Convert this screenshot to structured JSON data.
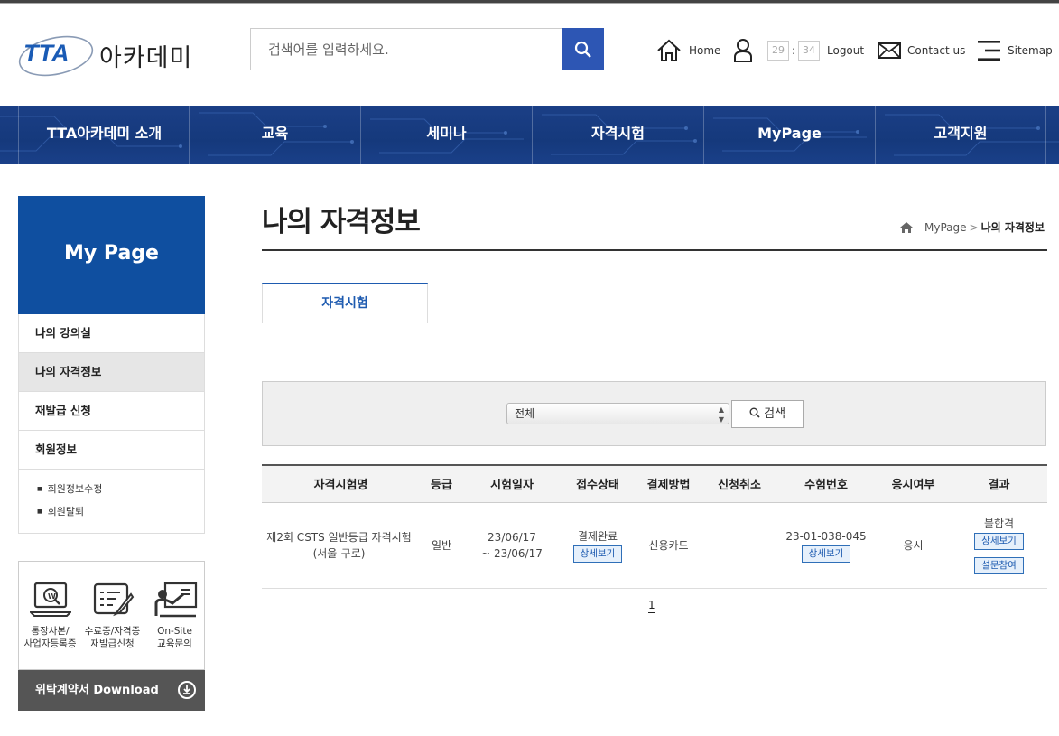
{
  "header": {
    "logo_text": "TTA",
    "brand": "아카데미",
    "search_placeholder": "검색어를 입력하세요.",
    "util": {
      "home": "Home",
      "timer_min": "29",
      "timer_sep": ":",
      "timer_sec": "34",
      "logout": "Logout",
      "contact": "Contact us",
      "sitemap": "Sitemap"
    }
  },
  "nav": [
    "TTA아카데미 소개",
    "교육",
    "세미나",
    "자격시험",
    "MyPage",
    "고객지원"
  ],
  "sidebar": {
    "title": "My Page",
    "items": [
      {
        "label": "나의 강의실"
      },
      {
        "label": "나의 자격정보"
      },
      {
        "label": "재발급 신청"
      },
      {
        "label": "회원정보"
      }
    ],
    "subitems": [
      "회원정보수정",
      "회원탈퇴"
    ],
    "quick": [
      {
        "line1": "통장사본/",
        "line2": "사업자등록증"
      },
      {
        "line1": "수료증/자격증",
        "line2": "재발급신청"
      },
      {
        "line1": "On-Site",
        "line2": "교육문의"
      }
    ],
    "download": "위탁계약서 Download"
  },
  "main": {
    "title": "나의 자격정보",
    "breadcrumb": {
      "parent": "MyPage",
      "sep": ">",
      "current": "나의 자격정보"
    },
    "tab": "자격시험",
    "filter": {
      "select_value": "전체",
      "search_button": "검색"
    },
    "table": {
      "headers": [
        "자격시험명",
        "등급",
        "시험일자",
        "접수상태",
        "결제방법",
        "신청취소",
        "수험번호",
        "응시여부",
        "결과"
      ],
      "row": {
        "name": "제2회 CSTS 일반등급 자격시험(서울-구로)",
        "grade": "일반",
        "date_from": "23/06/17",
        "date_to": "~ 23/06/17",
        "status": "결제완료",
        "detail": "상세보기",
        "payment": "신용카드",
        "cancel": "",
        "exam_no": "23-01-038-045",
        "attend": "응시",
        "result": "불합격",
        "survey": "설문참여"
      }
    },
    "page": "1"
  },
  "colors": {
    "primary": "#0f4fa0",
    "nav": "#15397c",
    "search_btn": "#2d56b4"
  }
}
